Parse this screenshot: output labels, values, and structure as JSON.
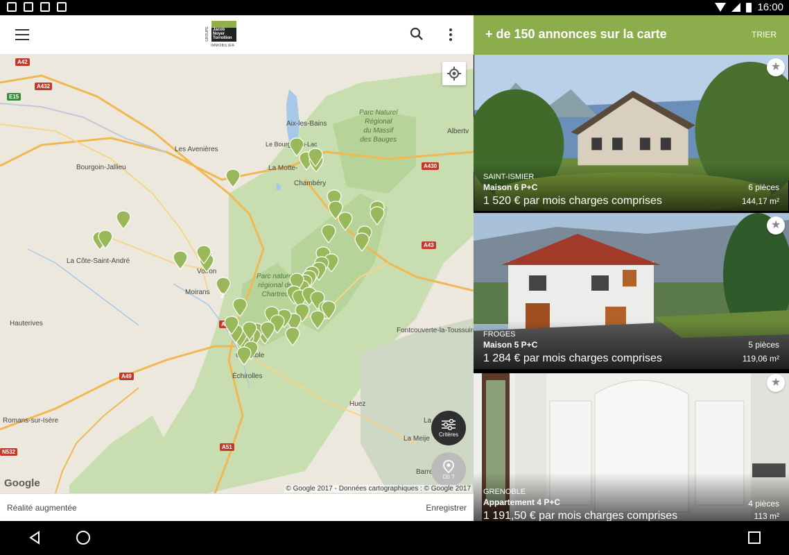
{
  "status_bar": {
    "time": "16:00"
  },
  "toolbar": {
    "logo": {
      "vertical": "GROUPE",
      "name": "Jacob Noyer Torrollion",
      "subtitle": "IMMOBILIER"
    }
  },
  "map": {
    "labels": {
      "aix": "Aix-les-Bains",
      "bourget": "Le Bourget-du-Lac",
      "motte": "La Motte-",
      "chambery": "Chambéry",
      "albertville": "Albertv",
      "avenieres": "Les Avenières",
      "bourgoin": "Bourgoin-Jallieu",
      "cote": "La Côte-Saint-André",
      "voiron": "Voiron",
      "moirans": "Moirans",
      "hauterives": "Hauterives",
      "grenoble": "Grenoble",
      "echirolles": "Échirolles",
      "romans": "Romans-sur-Isère",
      "huez": "Huez",
      "meije": "La Meije",
      "barre": "Barre",
      "fontcouverte": "Fontcouverte-la-Toussuire",
      "la": "La",
      "park_bauges": "Parc Naturel\nRégional\ndu Massif\ndes Bauges",
      "park_chartreuse": "Parc naturel\nrégional de\nChartreu"
    },
    "roads": [
      "A42",
      "A432",
      "E15",
      "A430",
      "A43",
      "A48",
      "A49",
      "A51",
      "N532"
    ],
    "cluster_count": "2",
    "google": "Google",
    "copyright": "© Google 2017 - Données cartographiques : © Google 2017",
    "criteria_label": "Critères",
    "where_label": "Où ?"
  },
  "bottom_bar": {
    "ar_label": "Réalité augmentée",
    "save_label": "Enregistrer"
  },
  "results": {
    "title": "+ de 150 annonces sur la carte",
    "sort_label": "TRIER",
    "listings": [
      {
        "city": "Saint-Ismier",
        "type": "Maison 6 P+C",
        "price": "1 520 € par mois charges comprises",
        "rooms": "6 pièces",
        "area": "144,17 m²"
      },
      {
        "city": "Froges",
        "type": "Maison 5 P+C",
        "price": "1 284 € par mois charges comprises",
        "rooms": "5 pièces",
        "area": "119,06 m²"
      },
      {
        "city": "Grenoble",
        "type": "Appartement 4 P+C",
        "price": "1 191,50 € par mois charges comprises",
        "rooms": "4 pièces",
        "area": "113 m²"
      }
    ]
  },
  "colors": {
    "accent": "#8cad4b",
    "marker": "#98b85a"
  },
  "icons": [
    "menu-icon",
    "search-icon",
    "more-icon",
    "locate-icon",
    "filter-icon",
    "place-icon",
    "star-icon",
    "back-icon",
    "home-icon",
    "recents-icon"
  ]
}
